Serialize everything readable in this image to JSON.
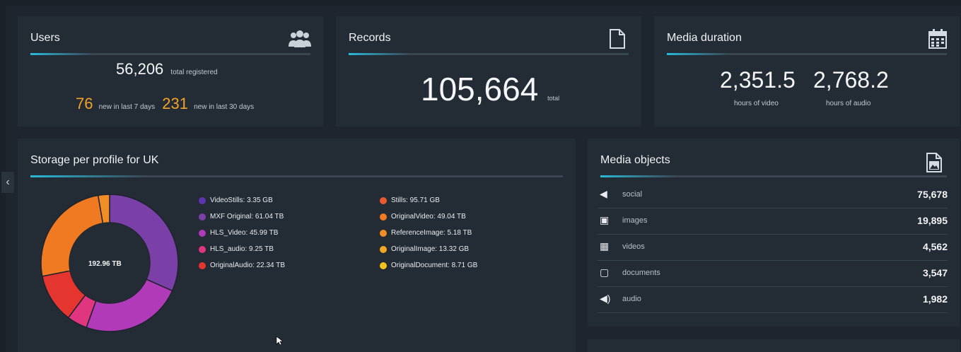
{
  "users": {
    "title": "Users",
    "icon": "users-icon",
    "total": "56,206",
    "total_label": "total registered",
    "new7": "76",
    "new7_label": "new in last 7 days",
    "new30": "231",
    "new30_label": "new in last 30 days"
  },
  "records": {
    "title": "Records",
    "icon": "document-icon",
    "total": "105,664",
    "total_label": "total"
  },
  "media_duration": {
    "title": "Media duration",
    "icon": "calendar-icon",
    "video": "2,351.5",
    "video_label": "hours of video",
    "audio": "2,768.2",
    "audio_label": "hours of audio"
  },
  "storage": {
    "title": "Storage per profile for UK",
    "center_label": "192.96 TB",
    "legend": [
      {
        "label": "VideoStills: 3.35 GB",
        "color": "#5e35b1"
      },
      {
        "label": "MXF Original: 61.04 TB",
        "color": "#7b3fa8"
      },
      {
        "label": "HLS_Video: 45.99 TB",
        "color": "#b03ab8"
      },
      {
        "label": "HLS_audio: 9.25 TB",
        "color": "#e0357f"
      },
      {
        "label": "OriginalAudio: 22.34 TB",
        "color": "#e5352f"
      },
      {
        "label": "Stills: 95.71 GB",
        "color": "#ea5a2e"
      },
      {
        "label": "OriginalVideo: 49.04 TB",
        "color": "#f07a22"
      },
      {
        "label": "ReferenceImage: 5.18 TB",
        "color": "#f08e25"
      },
      {
        "label": "OriginalImage: 13.32 GB",
        "color": "#f5a623"
      },
      {
        "label": "OriginalDocument: 8.71 GB",
        "color": "#f4c21c"
      }
    ]
  },
  "chart_data": {
    "type": "pie",
    "categories": [
      "MXF Original",
      "HLS_Video",
      "HLS_audio",
      "OriginalAudio",
      "OriginalVideo",
      "ReferenceImage"
    ],
    "values": [
      61.04,
      45.99,
      9.25,
      22.34,
      49.04,
      5.18
    ],
    "colors": [
      "#7b3fa8",
      "#b03ab8",
      "#e0357f",
      "#e5352f",
      "#f07a22",
      "#f08e25"
    ],
    "unit": "TB"
  },
  "media_objects": {
    "title": "Media objects",
    "icon": "image-file-icon",
    "rows": [
      {
        "icon": "share-icon",
        "glyph": "◀",
        "label": "social",
        "value": "75,678"
      },
      {
        "icon": "image-icon",
        "glyph": "▣",
        "label": "images",
        "value": "19,895"
      },
      {
        "icon": "film-icon",
        "glyph": "▦",
        "label": "videos",
        "value": "4,562"
      },
      {
        "icon": "document-icon",
        "glyph": "▢",
        "label": "documents",
        "value": "3,547"
      },
      {
        "icon": "speaker-icon",
        "glyph": "◀)",
        "label": "audio",
        "value": "1,982"
      }
    ]
  }
}
